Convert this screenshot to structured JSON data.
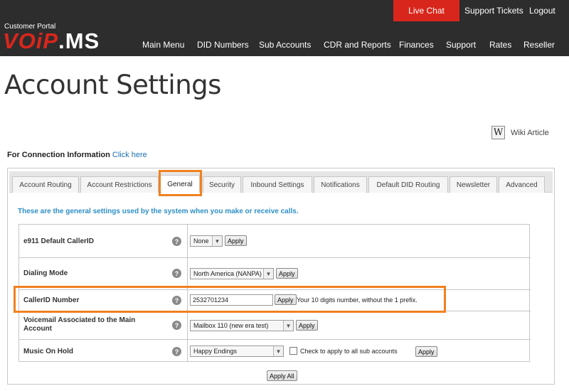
{
  "header": {
    "live_chat": "Live Chat",
    "support_tickets": "Support Tickets",
    "logout": "Logout",
    "portal_label": "Customer Portal",
    "logo_part1": "VOiP",
    "logo_part2": ".MS",
    "nav": [
      "Main Menu",
      "DID Numbers",
      "Sub Accounts",
      "CDR and Reports",
      "Finances",
      "Support",
      "Rates",
      "Reseller"
    ],
    "accent_color": "#d9261c"
  },
  "page": {
    "title": "Account Settings",
    "wiki_icon": "W",
    "wiki_label": "Wiki Article",
    "conn_info_label": "For Connection Information",
    "conn_info_link": "Click here"
  },
  "tabs": [
    "Account Routing",
    "Account Restrictions",
    "General",
    "Security",
    "Inbound Settings",
    "Notifications",
    "Default DID Routing",
    "Newsletter",
    "Advanced"
  ],
  "active_tab": "General",
  "intro": "These are the general settings used by the system when you make or receive calls.",
  "settings": {
    "e911": {
      "label": "e911 Default CallerID",
      "value": "None",
      "apply": "Apply"
    },
    "dialing_mode": {
      "label": "Dialing Mode",
      "value": "North America (NANPA)",
      "apply": "Apply"
    },
    "callerid": {
      "label": "CallerID Number",
      "value": "2532701234",
      "apply": "Apply",
      "note": "Your 10 digits number, without the 1 prefix."
    },
    "voicemail": {
      "label": "Voicemail Associated to the Main Account",
      "value": "Mailbox 110 (new era test)",
      "apply": "Apply"
    },
    "music_on_hold": {
      "label": "Music On Hold",
      "value": "Happy Endings",
      "checkbox_label": "Check to apply to all sub accounts",
      "apply": "Apply"
    },
    "apply_all": "Apply All",
    "help_glyph": "?"
  },
  "highlight_color": "#f0811f"
}
